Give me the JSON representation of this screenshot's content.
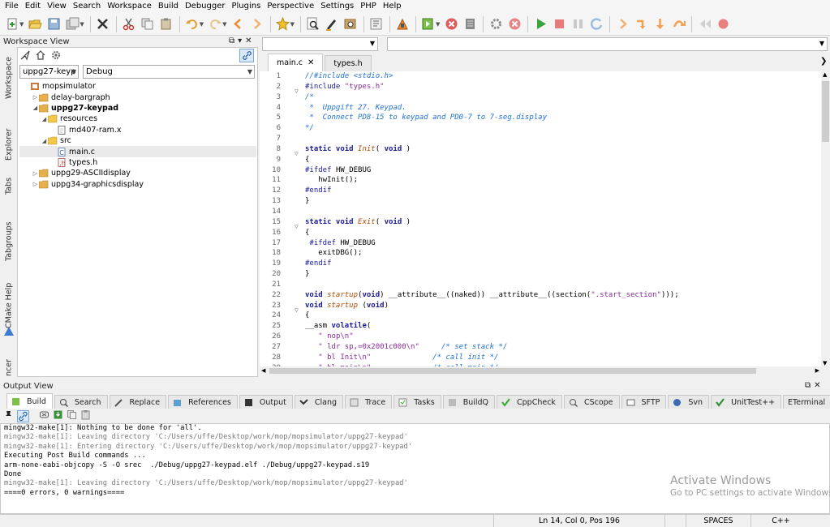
{
  "menu": [
    "File",
    "Edit",
    "View",
    "Search",
    "Workspace",
    "Build",
    "Debugger",
    "Plugins",
    "Perspective",
    "Settings",
    "PHP",
    "Help"
  ],
  "workspace": {
    "title": "Workspace View",
    "title_icons": [
      "⧉",
      "▾",
      "✕"
    ],
    "side_tabs": [
      "Workspace",
      "Explorer",
      "Tabs",
      "Tabgroups",
      "CMake Help",
      "ncer"
    ],
    "project_combo": "uppg27-keyp",
    "config_combo": "Debug",
    "tree": [
      {
        "label": "mopsimulator",
        "bold": false,
        "twist": "",
        "icon": "workspace-icon"
      },
      {
        "label": "delay-bargraph",
        "bold": false,
        "twist": "▷",
        "icon": "project-folder-icon"
      },
      {
        "label": "uppg27-keypad",
        "bold": true,
        "twist": "◢",
        "icon": "project-folder-icon"
      },
      {
        "label": "resources",
        "bold": false,
        "twist": "◢",
        "icon": "folder-icon"
      },
      {
        "label": "md407-ram.x",
        "bold": false,
        "twist": "",
        "icon": "file-icon"
      },
      {
        "label": "src",
        "bold": false,
        "twist": "◢",
        "icon": "folder-icon"
      },
      {
        "label": "main.c",
        "bold": false,
        "twist": "",
        "icon": "c-file-icon",
        "selected": true
      },
      {
        "label": "types.h",
        "bold": false,
        "twist": "",
        "icon": "h-file-icon"
      },
      {
        "label": "uppg29-ASCIIdisplay",
        "bold": false,
        "twist": "▷",
        "icon": "project-folder-icon"
      },
      {
        "label": "uppg34-graphicsdisplay",
        "bold": false,
        "twist": "▷",
        "icon": "project-folder-icon"
      }
    ]
  },
  "editor": {
    "tabs": [
      {
        "label": "main.c",
        "close": "✕",
        "active": true
      },
      {
        "label": "types.h",
        "close": "",
        "active": false
      }
    ],
    "line_numbers": [
      "1",
      "2",
      "3",
      "4",
      "5",
      "6",
      "7",
      "8",
      "9",
      "10",
      "11",
      "12",
      "13",
      "14",
      "15",
      "16",
      "17",
      "18",
      "19",
      "20",
      "21",
      "22",
      "23",
      "24",
      "25",
      "26",
      "27",
      "28",
      "29"
    ],
    "folds": [
      {
        "line": 3,
        "symbol": "▽"
      },
      {
        "line": 9,
        "symbol": "▽"
      },
      {
        "line": 16,
        "symbol": "▽"
      },
      {
        "line": 24,
        "symbol": "▽"
      }
    ],
    "lines": [
      [
        [
          "//#include <stdio.h>",
          "comment"
        ]
      ],
      [
        [
          "#include ",
          "pp"
        ],
        [
          "\"types.h\"",
          "str"
        ]
      ],
      [
        [
          "/*",
          "comment"
        ]
      ],
      [
        [
          " *  Uppgift 27. Keypad.",
          "comment"
        ]
      ],
      [
        [
          " *  Connect PD8-15 to keypad and PD0-7 to 7-seg.display",
          "comment"
        ]
      ],
      [
        [
          "*/",
          "comment"
        ]
      ],
      [
        [
          "",
          ""
        ]
      ],
      [
        [
          "static void ",
          "kw"
        ],
        [
          "Init",
          "fn"
        ],
        [
          "( ",
          "plain"
        ],
        [
          "void",
          "kw"
        ],
        [
          " )",
          "plain"
        ]
      ],
      [
        [
          "{",
          "plain"
        ]
      ],
      [
        [
          "#ifdef ",
          "pp"
        ],
        [
          "HW_DEBUG",
          "plain"
        ]
      ],
      [
        [
          "   hwInit();",
          "plain"
        ]
      ],
      [
        [
          "#endif",
          "pp"
        ]
      ],
      [
        [
          "}",
          "plain"
        ]
      ],
      [
        [
          "",
          ""
        ]
      ],
      [
        [
          "static void ",
          "kw"
        ],
        [
          "Exit",
          "fn"
        ],
        [
          "( ",
          "plain"
        ],
        [
          "void",
          "kw"
        ],
        [
          " )",
          "plain"
        ]
      ],
      [
        [
          "{",
          "plain"
        ]
      ],
      [
        [
          " #ifdef ",
          "pp"
        ],
        [
          "HW_DEBUG",
          "plain"
        ]
      ],
      [
        [
          "   exitDBG();",
          "plain"
        ]
      ],
      [
        [
          "#endif",
          "pp"
        ]
      ],
      [
        [
          "}",
          "plain"
        ]
      ],
      [
        [
          "",
          ""
        ]
      ],
      [
        [
          "void ",
          "kw"
        ],
        [
          "startup",
          "fn"
        ],
        [
          "(",
          "plain"
        ],
        [
          "void",
          "kw"
        ],
        [
          ") __attribute__((naked)) __attribute__((section(",
          "plain"
        ],
        [
          "\".start_section\"",
          "str"
        ],
        [
          ")));",
          "plain"
        ]
      ],
      [
        [
          "void ",
          "kw"
        ],
        [
          "startup",
          "fn"
        ],
        [
          " (",
          "plain"
        ],
        [
          "void",
          "kw"
        ],
        [
          ")",
          "plain"
        ]
      ],
      [
        [
          "{",
          "plain"
        ]
      ],
      [
        [
          "__asm ",
          "plain"
        ],
        [
          "volatile",
          "kw"
        ],
        [
          "(",
          "plain"
        ]
      ],
      [
        [
          "   ",
          "plain"
        ],
        [
          "\" nop\\n\"",
          "str"
        ]
      ],
      [
        [
          "   ",
          "plain"
        ],
        [
          "\" ldr sp,=0x2001c000\\n\"",
          "str"
        ],
        [
          "     ",
          "plain"
        ],
        [
          "/* set stack */",
          "comment"
        ]
      ],
      [
        [
          "   ",
          "plain"
        ],
        [
          "\" bl Init\\n\"",
          "str"
        ],
        [
          "              ",
          "plain"
        ],
        [
          "/* call init */",
          "comment"
        ]
      ],
      [
        [
          "   ",
          "plain"
        ],
        [
          "\" bl main\\n\"",
          "str"
        ],
        [
          "              ",
          "plain"
        ],
        [
          "/* call main */",
          "comment"
        ]
      ]
    ]
  },
  "output": {
    "title": "Output View",
    "title_icons": [
      "⧉",
      "✕"
    ],
    "tabs": [
      {
        "label": "Build",
        "icon": "build-icon",
        "active": true
      },
      {
        "label": "Search",
        "icon": "search-icon"
      },
      {
        "label": "Replace",
        "icon": "replace-icon"
      },
      {
        "label": "References",
        "icon": "references-icon"
      },
      {
        "label": "Output",
        "icon": "output-icon"
      },
      {
        "label": "Clang",
        "icon": "clang-icon"
      },
      {
        "label": "Trace",
        "icon": "trace-icon"
      },
      {
        "label": "Tasks",
        "icon": "tasks-icon"
      },
      {
        "label": "BuildQ",
        "icon": "buildq-icon"
      },
      {
        "label": "CppCheck",
        "icon": "cppcheck-icon"
      },
      {
        "label": "CScope",
        "icon": "cscope-icon"
      },
      {
        "label": "SFTP",
        "icon": "sftp-icon"
      },
      {
        "label": "Svn",
        "icon": "svn-icon"
      },
      {
        "label": "UnitTest++",
        "icon": "unittest-icon"
      },
      {
        "label": "ETerminal",
        "icon": "terminal-icon"
      },
      {
        "label": "",
        "icon": "git-icon"
      }
    ],
    "lines": [
      {
        "text": "mingw32-make[1]: Nothing to be done for 'all'.",
        "gray": false
      },
      {
        "text": "mingw32-make[1]: Leaving directory 'C:/Users/uffe/Desktop/work/mop/mopsimulator/uppg27-keypad'",
        "gray": true
      },
      {
        "text": "mingw32-make[1]: Entering directory 'C:/Users/uffe/Desktop/work/mop/mopsimulator/uppg27-keypad'",
        "gray": true
      },
      {
        "text": "Executing Post Build commands ...",
        "gray": false
      },
      {
        "text": "arm-none-eabi-objcopy -S -O srec  ./Debug/uppg27-keypad.elf ./Debug/uppg27-keypad.s19",
        "gray": false
      },
      {
        "text": "Done",
        "gray": false
      },
      {
        "text": "mingw32-make[1]: Leaving directory 'C:/Users/uffe/Desktop/work/mop/mopsimulator/uppg27-keypad'",
        "gray": true
      },
      {
        "text": "====0 errors, 0 warnings====",
        "gray": false
      }
    ]
  },
  "watermark": {
    "line1": "Activate Windows",
    "line2": "Go to PC settings to activate Windows."
  },
  "status": {
    "position": "Ln 14, Col 0, Pos 196",
    "indent": "SPACES",
    "language": "C++"
  }
}
